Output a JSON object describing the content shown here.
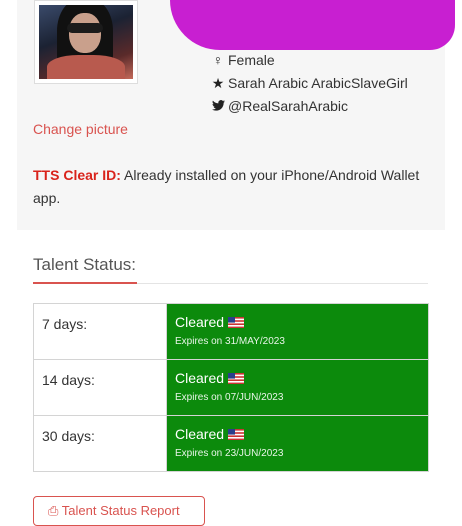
{
  "profile": {
    "gender": "Female",
    "name": "Sarah Arabic ArabicSlaveGirl",
    "twitter": "@RealSarahArabic",
    "change_picture": "Change picture"
  },
  "tts": {
    "label": "TTS Clear ID:",
    "text": " Already installed on your iPhone/Android Wallet app."
  },
  "talent_status": {
    "title": "Talent Status:",
    "rows": [
      {
        "period": "7 days:",
        "status": "Cleared",
        "expires": "Expires on 31/MAY/2023"
      },
      {
        "period": "14 days:",
        "status": "Cleared",
        "expires": "Expires on 07/JUN/2023"
      },
      {
        "period": "30 days:",
        "status": "Cleared",
        "expires": "Expires on 23/JUN/2023"
      }
    ],
    "status_color": "#0c8a0c",
    "report_button": "Talent Status Report"
  },
  "colors": {
    "accent": "#d9534f",
    "redaction": "#c81fd1"
  },
  "icons": {
    "gender": "female-icon",
    "name": "star-icon",
    "twitter": "twitter-icon",
    "flag": "us-flag-icon",
    "report": "pdf-icon"
  }
}
